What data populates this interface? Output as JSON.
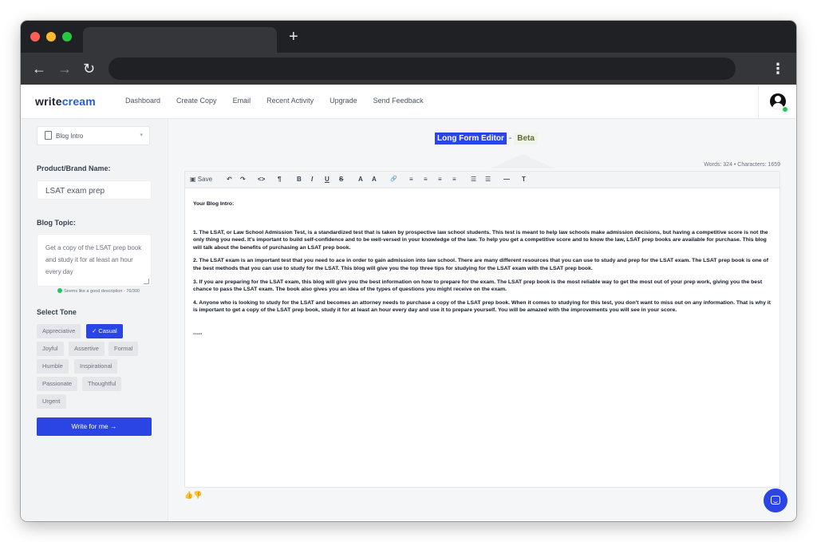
{
  "browser": {
    "new_tab": "+",
    "back": "←",
    "forward": "→",
    "reload": "↻",
    "menu": "⋮"
  },
  "header": {
    "logo_write": "write",
    "logo_cream": "cream",
    "nav": [
      "Dashboard",
      "Create Copy",
      "Email",
      "Recent Activity",
      "Upgrade",
      "Send Feedback"
    ]
  },
  "sidebar": {
    "template_select": "Blog Intro",
    "product_label": "Product/Brand Name:",
    "product_value": "LSAT exam prep",
    "topic_label": "Blog Topic:",
    "topic_value": "Get a copy of the LSAT prep book and study it for at least an hour every day",
    "topic_hint": "Seems like a good description - 76/300",
    "tone_label": "Select Tone",
    "tones": [
      "Appreciative",
      "Casual",
      "Joyful",
      "Assertive",
      "Formal",
      "Humble",
      "Inspirational",
      "Passionate",
      "Thoughtful",
      "Urgent"
    ],
    "selected_tone": "Casual",
    "write_button": "Write for me →"
  },
  "editor": {
    "title": "Long Form Editor",
    "separator": "-",
    "badge": "Beta",
    "counts": "Words: 324 • Characters: 1659",
    "toolbar": {
      "save": "Save",
      "undo": "↶",
      "redo": "↷",
      "code": "<>",
      "paragraph": "¶",
      "bold": "B",
      "italic": "I",
      "underline": "U",
      "strike": "S",
      "superscript": "A",
      "subscript": "A",
      "link": "🔗",
      "align_left": "≡",
      "align_center": "≡",
      "align_right": "≡",
      "justify": "≡",
      "bullets": "☰",
      "numbers": "☰",
      "hr": "—",
      "clear": "T"
    },
    "heading": "Your Blog Intro:",
    "paragraphs": [
      "1. The LSAT, or Law School Admission Test, is a standardized test that is taken by prospective law school students. This test is meant to help law schools make admission decisions, but having a competitive score is not the only thing you need. It's important to build self-confidence and to be well-versed in your knowledge of the law. To help you get a competitive score and to know the law, LSAT prep books are available for purchase. This blog will talk about the benefits of purchasing an LSAT prep book.",
      "2.  The LSAT exam is an important test that you need to ace in order to gain admission into law school. There are many different resources that you can use to study and prep for the LSAT exam. The LSAT prep book is one of the best methods that you can use to study for the LSAT. This blog will give you the top three tips for studying for the LSAT exam with the LSAT prep book.",
      "3. If you are preparing for the LSAT exam, this blog will give you the best information on how to prepare for the exam. The LSAT prep book is the most reliable way to get the most out of your prep work, giving you the best chance to pass the LSAT exam. The book also gives you an idea of the types of questions you might receive on the exam.",
      "4. Anyone who is looking to study for the LSAT and becomes an attorney needs to purchase a copy of the LSAT prep book. When it comes to studying for this test, you don't want to miss out on any information. That is why it is important to get a copy of the LSAT prep book, study it for at least an hour every day and use it to prepare yourself. You will be amazed with the improvements you will see in your score."
    ],
    "separator_line": "-----",
    "feedback": "👍👎"
  }
}
